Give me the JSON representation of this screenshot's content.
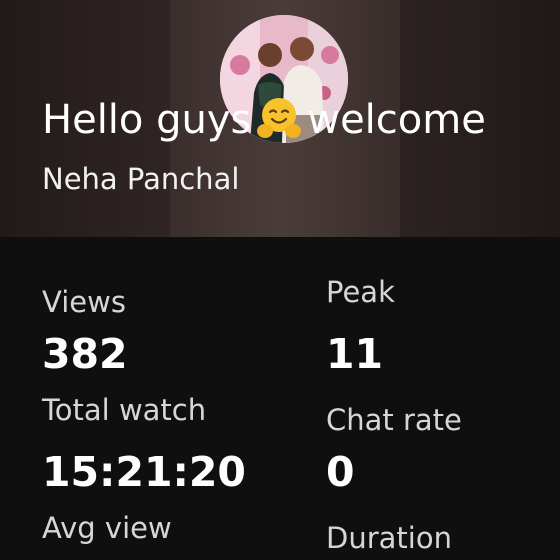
{
  "stream": {
    "title_before": "Hello guys",
    "title_after": "welcome",
    "emoji": "hugging-face",
    "channel": "Neha Panchal"
  },
  "stats": {
    "views_label": "Views",
    "views_value": "382",
    "peak_label": "Peak",
    "peak_value": "11",
    "total_watch_label": "Total watch",
    "total_watch_value": "15:21:20",
    "chat_rate_label": "Chat rate",
    "chat_rate_value": "0",
    "avg_view_label": "Avg view",
    "duration_label": "Duration"
  },
  "colors": {
    "background": "#0f0f0f",
    "header": "#3a2e2c",
    "text": "#ffffff",
    "label": "#d6d6d6"
  }
}
